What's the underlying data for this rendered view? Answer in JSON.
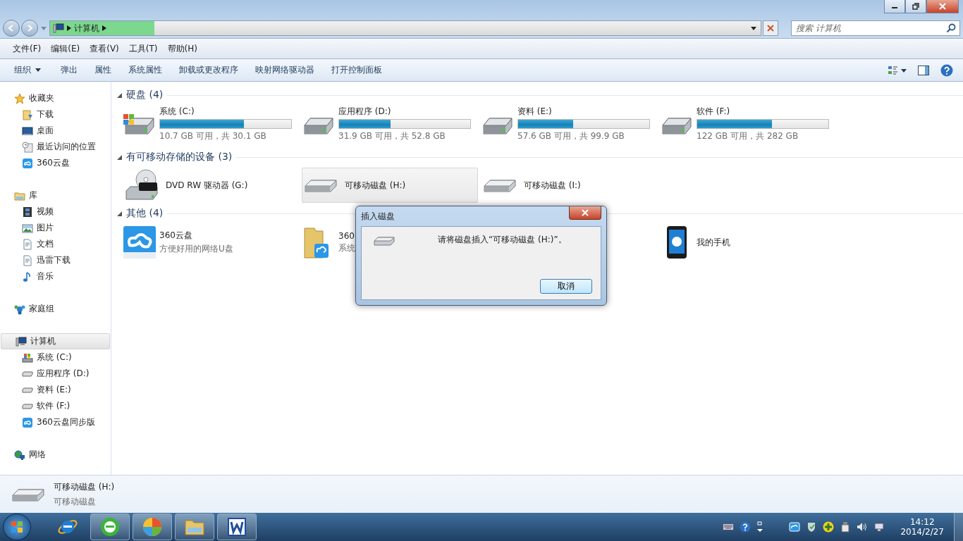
{
  "address_bar": {
    "path": [
      "计算机"
    ]
  },
  "search": {
    "placeholder": "搜索 计算机"
  },
  "menu": [
    "文件(F)",
    "编辑(E)",
    "查看(V)",
    "工具(T)",
    "帮助(H)"
  ],
  "toolbar": {
    "organize": "组织",
    "commands": [
      "弹出",
      "属性",
      "系统属性",
      "卸载或更改程序",
      "映射网络驱动器",
      "打开控制面板"
    ]
  },
  "sidebar": [
    {
      "label": "收藏夹",
      "selected": false,
      "children": [
        {
          "label": "下载",
          "selected": false
        },
        {
          "label": "桌面",
          "selected": false
        },
        {
          "label": "最近访问的位置",
          "selected": false
        },
        {
          "label": "360云盘",
          "selected": false
        }
      ]
    },
    {
      "label": "库",
      "selected": false,
      "children": [
        {
          "label": "视频",
          "selected": false
        },
        {
          "label": "图片",
          "selected": false
        },
        {
          "label": "文档",
          "selected": false
        },
        {
          "label": "迅雷下载",
          "selected": false
        },
        {
          "label": "音乐",
          "selected": false
        }
      ]
    },
    {
      "label": "家庭组",
      "selected": false
    },
    {
      "label": "计算机",
      "selected": true,
      "children": [
        {
          "label": "系统 (C:)",
          "selected": false
        },
        {
          "label": "应用程序 (D:)",
          "selected": false
        },
        {
          "label": "资料 (E:)",
          "selected": false
        },
        {
          "label": "软件 (F:)",
          "selected": false
        },
        {
          "label": "360云盘同步版",
          "selected": false
        }
      ]
    },
    {
      "label": "网络",
      "selected": false
    }
  ],
  "hard_disks": {
    "title": "硬盘 (4)",
    "expanded": true,
    "items": [
      {
        "name": "系统 (C:)",
        "level": 0.64,
        "space": "10.7 GB 可用，共 30.1 GB"
      },
      {
        "name": "应用程序 (D:)",
        "level": 0.39,
        "space": "31.9 GB 可用，共 52.8 GB"
      },
      {
        "name": "资料 (E:)",
        "level": 0.42,
        "space": "57.6 GB 可用，共 99.9 GB"
      },
      {
        "name": "软件 (F:)",
        "level": 0.57,
        "space": "122 GB 可用，共 282 GB"
      }
    ]
  },
  "removable": {
    "title": "有可移动存储的设备 (3)",
    "expanded": true,
    "items": [
      {
        "name": "DVD RW 驱动器 (G:)",
        "selected": false
      },
      {
        "name": "可移动磁盘 (H:)",
        "selected": true
      },
      {
        "name": "可移动磁盘 (I:)",
        "selected": false
      }
    ]
  },
  "other": {
    "title": "其他 (4)",
    "expanded": true,
    "items": [
      {
        "name": "360云盘",
        "subtitle": "方便好用的网络U盘"
      },
      {
        "name": "360",
        "subtitle": "系统"
      },
      {
        "name": "我的手机"
      }
    ]
  },
  "dialog": {
    "title": "插入磁盘",
    "message": "请将磁盘插入“可移动磁盘 (H:)”。",
    "button": "取消"
  },
  "details": {
    "name": "可移动磁盘 (H:)",
    "type": "可移动磁盘"
  },
  "taskbar": {
    "apps": [
      {
        "running": false
      },
      {
        "running": true
      },
      {
        "running": true
      },
      {
        "running": true
      },
      {
        "running": true
      }
    ],
    "time": "14:12",
    "date": "2014/2/27"
  }
}
